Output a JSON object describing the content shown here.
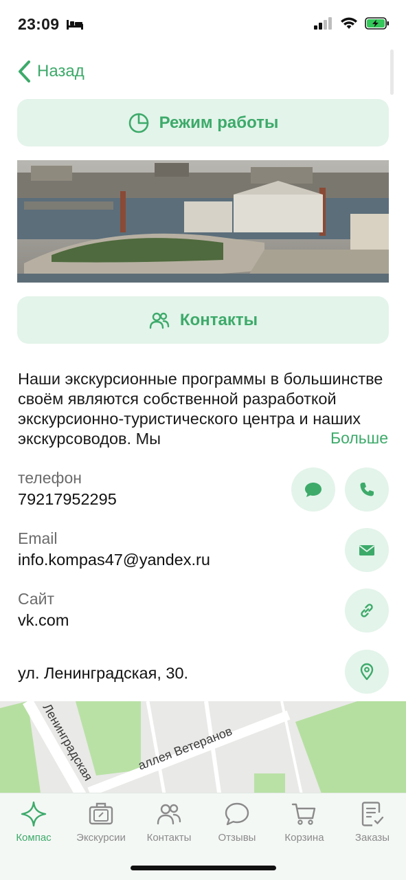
{
  "status_bar": {
    "time": "23:09"
  },
  "nav": {
    "back_label": "Назад"
  },
  "buttons": {
    "hours_label": "Режим работы",
    "contacts_label": "Контакты"
  },
  "description": {
    "text": "Наши экскурсионные программы в большинстве своём являются собственной разработкой экскурсионно-туристического центра и наших экскурсоводов. Мы",
    "more_label": "Больше"
  },
  "contacts": {
    "phone_label": "телефон",
    "phone_value": "79217952295",
    "email_label": "Email",
    "email_value": "info.kompas47@yandex.ru",
    "site_label": "Сайт",
    "site_value": "vk.com",
    "address_value": "ул. Ленинградская, 30."
  },
  "map": {
    "street_1": "Ленинградская",
    "street_2": "аллея Ветеранов"
  },
  "tabs": [
    {
      "label": "Компас",
      "icon": "star-icon",
      "active": true
    },
    {
      "label": "Экскурсии",
      "icon": "suitcase-icon",
      "active": false
    },
    {
      "label": "Контакты",
      "icon": "people-icon",
      "active": false
    },
    {
      "label": "Отзывы",
      "icon": "chat-bubble-icon",
      "active": false
    },
    {
      "label": "Корзина",
      "icon": "cart-icon",
      "active": false
    },
    {
      "label": "Заказы",
      "icon": "order-list-icon",
      "active": false
    }
  ],
  "colors": {
    "accent": "#3daa6a",
    "accent_bg": "#e3f4ea",
    "tab_inactive": "#8a8a8a"
  }
}
